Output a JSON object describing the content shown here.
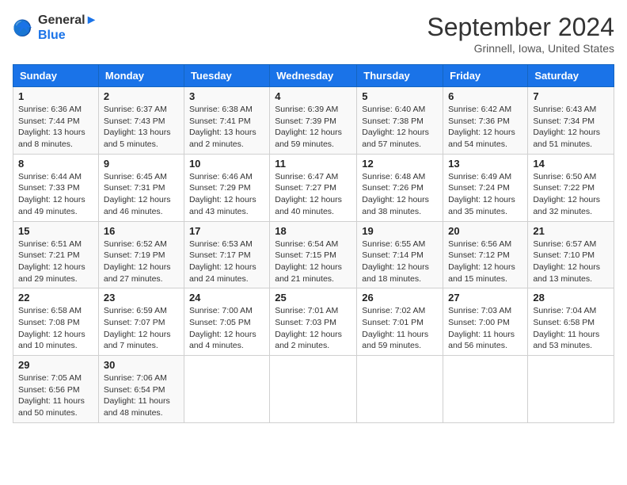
{
  "logo": {
    "line1": "General",
    "line2": "Blue"
  },
  "title": "September 2024",
  "location": "Grinnell, Iowa, United States",
  "days_of_week": [
    "Sunday",
    "Monday",
    "Tuesday",
    "Wednesday",
    "Thursday",
    "Friday",
    "Saturday"
  ],
  "weeks": [
    [
      {
        "day": "1",
        "rise": "6:36 AM",
        "set": "7:44 PM",
        "daylight": "13 hours and 8 minutes."
      },
      {
        "day": "2",
        "rise": "6:37 AM",
        "set": "7:43 PM",
        "daylight": "13 hours and 5 minutes."
      },
      {
        "day": "3",
        "rise": "6:38 AM",
        "set": "7:41 PM",
        "daylight": "13 hours and 2 minutes."
      },
      {
        "day": "4",
        "rise": "6:39 AM",
        "set": "7:39 PM",
        "daylight": "12 hours and 59 minutes."
      },
      {
        "day": "5",
        "rise": "6:40 AM",
        "set": "7:38 PM",
        "daylight": "12 hours and 57 minutes."
      },
      {
        "day": "6",
        "rise": "6:42 AM",
        "set": "7:36 PM",
        "daylight": "12 hours and 54 minutes."
      },
      {
        "day": "7",
        "rise": "6:43 AM",
        "set": "7:34 PM",
        "daylight": "12 hours and 51 minutes."
      }
    ],
    [
      {
        "day": "8",
        "rise": "6:44 AM",
        "set": "7:33 PM",
        "daylight": "12 hours and 49 minutes."
      },
      {
        "day": "9",
        "rise": "6:45 AM",
        "set": "7:31 PM",
        "daylight": "12 hours and 46 minutes."
      },
      {
        "day": "10",
        "rise": "6:46 AM",
        "set": "7:29 PM",
        "daylight": "12 hours and 43 minutes."
      },
      {
        "day": "11",
        "rise": "6:47 AM",
        "set": "7:27 PM",
        "daylight": "12 hours and 40 minutes."
      },
      {
        "day": "12",
        "rise": "6:48 AM",
        "set": "7:26 PM",
        "daylight": "12 hours and 38 minutes."
      },
      {
        "day": "13",
        "rise": "6:49 AM",
        "set": "7:24 PM",
        "daylight": "12 hours and 35 minutes."
      },
      {
        "day": "14",
        "rise": "6:50 AM",
        "set": "7:22 PM",
        "daylight": "12 hours and 32 minutes."
      }
    ],
    [
      {
        "day": "15",
        "rise": "6:51 AM",
        "set": "7:21 PM",
        "daylight": "12 hours and 29 minutes."
      },
      {
        "day": "16",
        "rise": "6:52 AM",
        "set": "7:19 PM",
        "daylight": "12 hours and 27 minutes."
      },
      {
        "day": "17",
        "rise": "6:53 AM",
        "set": "7:17 PM",
        "daylight": "12 hours and 24 minutes."
      },
      {
        "day": "18",
        "rise": "6:54 AM",
        "set": "7:15 PM",
        "daylight": "12 hours and 21 minutes."
      },
      {
        "day": "19",
        "rise": "6:55 AM",
        "set": "7:14 PM",
        "daylight": "12 hours and 18 minutes."
      },
      {
        "day": "20",
        "rise": "6:56 AM",
        "set": "7:12 PM",
        "daylight": "12 hours and 15 minutes."
      },
      {
        "day": "21",
        "rise": "6:57 AM",
        "set": "7:10 PM",
        "daylight": "12 hours and 13 minutes."
      }
    ],
    [
      {
        "day": "22",
        "rise": "6:58 AM",
        "set": "7:08 PM",
        "daylight": "12 hours and 10 minutes."
      },
      {
        "day": "23",
        "rise": "6:59 AM",
        "set": "7:07 PM",
        "daylight": "12 hours and 7 minutes."
      },
      {
        "day": "24",
        "rise": "7:00 AM",
        "set": "7:05 PM",
        "daylight": "12 hours and 4 minutes."
      },
      {
        "day": "25",
        "rise": "7:01 AM",
        "set": "7:03 PM",
        "daylight": "12 hours and 2 minutes."
      },
      {
        "day": "26",
        "rise": "7:02 AM",
        "set": "7:01 PM",
        "daylight": "11 hours and 59 minutes."
      },
      {
        "day": "27",
        "rise": "7:03 AM",
        "set": "7:00 PM",
        "daylight": "11 hours and 56 minutes."
      },
      {
        "day": "28",
        "rise": "7:04 AM",
        "set": "6:58 PM",
        "daylight": "11 hours and 53 minutes."
      }
    ],
    [
      {
        "day": "29",
        "rise": "7:05 AM",
        "set": "6:56 PM",
        "daylight": "11 hours and 50 minutes."
      },
      {
        "day": "30",
        "rise": "7:06 AM",
        "set": "6:54 PM",
        "daylight": "11 hours and 48 minutes."
      },
      null,
      null,
      null,
      null,
      null
    ]
  ],
  "labels": {
    "sunrise": "Sunrise:",
    "sunset": "Sunset:",
    "daylight": "Daylight:"
  }
}
